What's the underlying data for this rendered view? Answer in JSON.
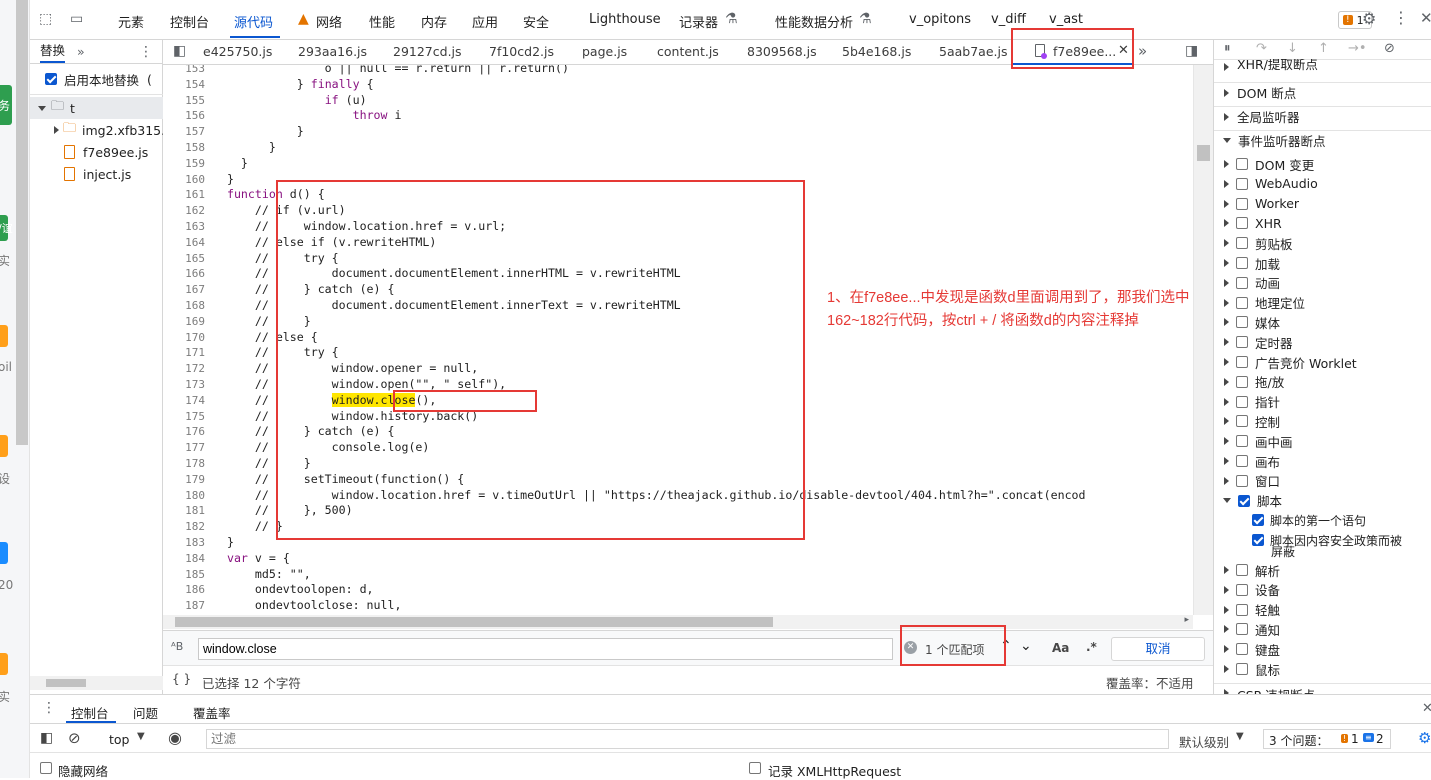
{
  "toolbar": {
    "tabs": [
      "元素",
      "控制台",
      "源代码",
      "网络",
      "性能",
      "内存",
      "应用",
      "安全",
      "Lighthouse",
      "记录器",
      "性能数据分析",
      "v_opitons",
      "v_diff",
      "v_ast"
    ],
    "issues_count": "1"
  },
  "left_panel": {
    "tab_label": "替换",
    "enable_label": "启用本地替换",
    "enable_suffix": "(",
    "tree": {
      "root": "t",
      "items": [
        "img2.xfb315.",
        "f7e89ee.js",
        "inject.js"
      ]
    }
  },
  "editor": {
    "tabs": [
      "e425750.js",
      "293aa16.js",
      "29127cd.js",
      "7f10cd2.js",
      "page.js",
      "content.js",
      "8309568.js",
      "5b4e168.js",
      "5aab7ae.js",
      "f7e89ee..."
    ],
    "lines": [
      {
        "n": "153",
        "t": "                o || null == r.return || r.return()"
      },
      {
        "n": "154",
        "t": "            } finally {"
      },
      {
        "n": "155",
        "t": "                if (u)"
      },
      {
        "n": "156",
        "t": "                    throw i"
      },
      {
        "n": "157",
        "t": "            }"
      },
      {
        "n": "158",
        "t": "        }"
      },
      {
        "n": "159",
        "t": "    }"
      },
      {
        "n": "160",
        "t": "  }"
      },
      {
        "n": "161",
        "t": "  function d() {"
      },
      {
        "n": "162",
        "t": "      // if (v.url)"
      },
      {
        "n": "163",
        "t": "      //     window.location.href = v.url;"
      },
      {
        "n": "164",
        "t": "      // else if (v.rewriteHTML)"
      },
      {
        "n": "165",
        "t": "      //     try {"
      },
      {
        "n": "166",
        "t": "      //         document.documentElement.innerHTML = v.rewriteHTML"
      },
      {
        "n": "167",
        "t": "      //     } catch (e) {"
      },
      {
        "n": "168",
        "t": "      //         document.documentElement.innerText = v.rewriteHTML"
      },
      {
        "n": "169",
        "t": "      //     }"
      },
      {
        "n": "170",
        "t": "      // else {"
      },
      {
        "n": "171",
        "t": "      //     try {"
      },
      {
        "n": "172",
        "t": "      //         window.opener = null,"
      },
      {
        "n": "173",
        "t": "      //         window.open(\"\", \"_self\"),"
      },
      {
        "n": "174",
        "t": "      //         window.close(),"
      },
      {
        "n": "175",
        "t": "      //         window.history.back()"
      },
      {
        "n": "176",
        "t": "      //     } catch (e) {"
      },
      {
        "n": "177",
        "t": "      //         console.log(e)"
      },
      {
        "n": "178",
        "t": "      //     }"
      },
      {
        "n": "179",
        "t": "      //     setTimeout(function() {"
      },
      {
        "n": "180",
        "t": "      //         window.location.href = v.timeOutUrl || \"https://theajack.github.io/disable-devtool/404.html?h=\".concat(encod"
      },
      {
        "n": "181",
        "t": "      //     }, 500)"
      },
      {
        "n": "182",
        "t": "      // }"
      },
      {
        "n": "183",
        "t": "  }"
      },
      {
        "n": "184",
        "t": "  var v = {"
      },
      {
        "n": "185",
        "t": "      md5: \"\","
      },
      {
        "n": "186",
        "t": "      ondevtoolopen: d,"
      },
      {
        "n": "187",
        "t": "      ondevtoolclose: null,"
      }
    ]
  },
  "search": {
    "query": "window.close",
    "match_count": "1 个匹配项",
    "case_label": "Aa",
    "regex_label": ".*",
    "cancel_label": "取消"
  },
  "status": {
    "selection": "已选择 12 个字符",
    "coverage": "覆盖率：不适用"
  },
  "annotation": {
    "text": "1、在f7e8ee...中发现是函数d里面调用到了，那我们选中162~182行代码，按ctrl + / 将函数d的内容注释掉"
  },
  "right_panel": {
    "sections": [
      "XHR/提取断点",
      "DOM 断点",
      "全局监听器",
      "事件监听器断点"
    ],
    "events": [
      {
        "label": "DOM 变更",
        "checked": false
      },
      {
        "label": "WebAudio",
        "checked": false
      },
      {
        "label": "Worker",
        "checked": false
      },
      {
        "label": "XHR",
        "checked": false
      },
      {
        "label": "剪贴板",
        "checked": false
      },
      {
        "label": "加载",
        "checked": false
      },
      {
        "label": "动画",
        "checked": false
      },
      {
        "label": "地理定位",
        "checked": false
      },
      {
        "label": "媒体",
        "checked": false
      },
      {
        "label": "定时器",
        "checked": false
      },
      {
        "label": "广告竞价 Worklet",
        "checked": false
      },
      {
        "label": "拖/放",
        "checked": false
      },
      {
        "label": "指针",
        "checked": false
      },
      {
        "label": "控制",
        "checked": false
      },
      {
        "label": "画中画",
        "checked": false
      },
      {
        "label": "画布",
        "checked": false
      },
      {
        "label": "窗口",
        "checked": false
      },
      {
        "label": "脚本",
        "checked": true
      }
    ],
    "script_sub": [
      "脚本的第一个语句",
      "脚本因内容安全政策而被",
      "屏蔽"
    ],
    "events_after": [
      "解析",
      "设备",
      "轻触",
      "通知",
      "键盘",
      "鼠标"
    ],
    "csp_label": "CSP 违规断点"
  },
  "drawer": {
    "tabs": [
      "控制台",
      "问题",
      "覆盖率"
    ],
    "context": "top",
    "filter_placeholder": "过滤",
    "level": "默认级别",
    "issues_label": "3 个问题：",
    "issues_warn": "1",
    "issues_info": "2",
    "hide_network": "隐藏网络",
    "log_xhr": "记录 XMLHttpRequest"
  },
  "page_strip": {
    "fragments": [
      "务",
      "/谊",
      "实",
      "oil",
      "设",
      "20",
      "实"
    ]
  }
}
